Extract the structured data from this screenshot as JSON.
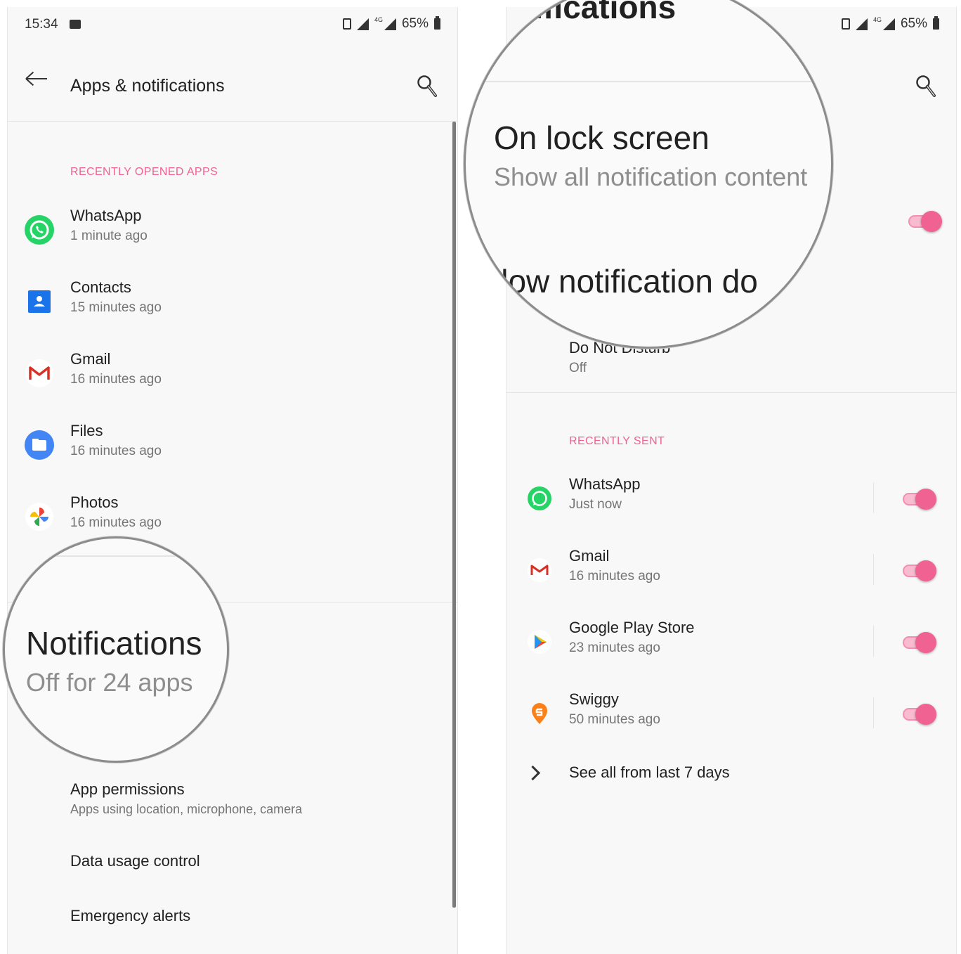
{
  "left": {
    "status": {
      "time": "15:34",
      "battery": "65%",
      "network": "4G"
    },
    "appbar": {
      "title": "Apps & notifications"
    },
    "section_label": "RECENTLY OPENED APPS",
    "recent_apps": [
      {
        "name": "WhatsApp",
        "time": "1 minute ago",
        "icon": "whatsapp-icon"
      },
      {
        "name": "Contacts",
        "time": "15 minutes ago",
        "icon": "contacts-icon"
      },
      {
        "name": "Gmail",
        "time": "16 minutes ago",
        "icon": "gmail-icon"
      },
      {
        "name": "Files",
        "time": "16 minutes ago",
        "icon": "files-icon"
      },
      {
        "name": "Photos",
        "time": "16 minutes ago",
        "icon": "photos-icon"
      }
    ],
    "notifications": {
      "title": "Notifications",
      "subtitle": "Off for 24 apps"
    },
    "items": [
      {
        "name": "App permissions",
        "sub": "Apps using location, microphone, camera"
      },
      {
        "name": "Data usage control"
      },
      {
        "name": "Emergency alerts"
      }
    ]
  },
  "right": {
    "status": {
      "battery": "65%",
      "network": "4G"
    },
    "appbar_partial_title": "tifications",
    "lock_screen": {
      "title": "On lock screen",
      "subtitle": "Show all notification content"
    },
    "allow_dots_partial": "llow notification do",
    "dnd": {
      "name": "Do Not Disturb",
      "value": "Off"
    },
    "section_label": "RECENTLY SENT",
    "recent_sent": [
      {
        "name": "WhatsApp",
        "time": "Just now",
        "icon": "whatsapp-icon",
        "enabled": true
      },
      {
        "name": "Gmail",
        "time": "16 minutes ago",
        "icon": "gmail-icon",
        "enabled": true
      },
      {
        "name": "Google Play Store",
        "time": "23 minutes ago",
        "icon": "play-store-icon",
        "enabled": true
      },
      {
        "name": "Swiggy",
        "time": "50 minutes ago",
        "icon": "swiggy-icon",
        "enabled": true
      }
    ],
    "see_all": "See all from last 7 days"
  },
  "colors": {
    "accent": "#f06292",
    "panel_bg": "#f8f8f8",
    "text": "#212121",
    "secondary": "#757575"
  }
}
